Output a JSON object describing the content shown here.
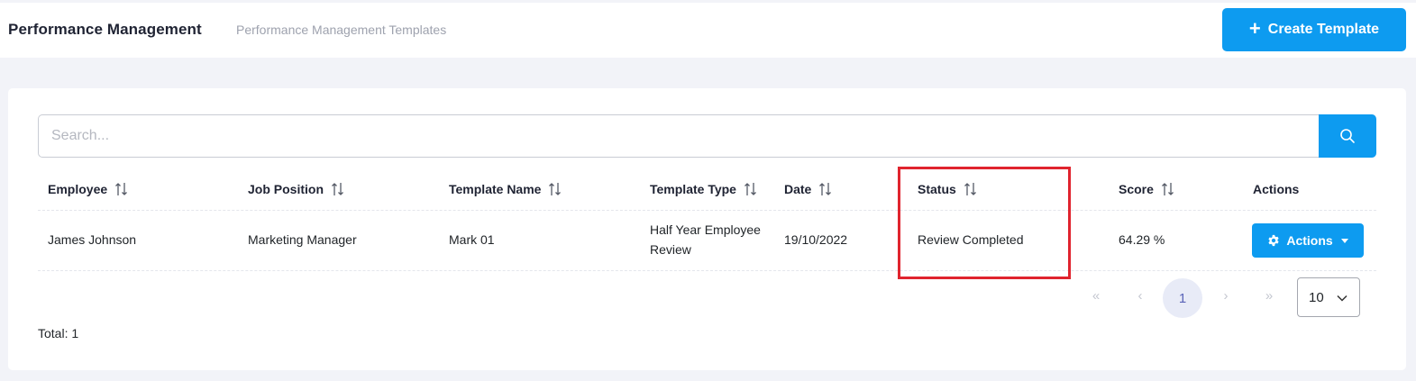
{
  "header": {
    "title": "Performance Management",
    "subtitle": "Performance Management Templates",
    "create_label": "Create Template"
  },
  "search": {
    "placeholder": "Search..."
  },
  "table": {
    "columns": [
      "Employee",
      "Job Position",
      "Template Name",
      "Template Type",
      "Date",
      "Status",
      "Score",
      "Actions"
    ],
    "rows": [
      {
        "employee": "James Johnson",
        "job_position": "Marketing Manager",
        "template_name": "Mark 01",
        "template_type_line1": "Half Year Employee",
        "template_type_line2": "Review",
        "date": "19/10/2022",
        "status": "Review Completed",
        "score": "64.29 %",
        "actions_label": "Actions"
      }
    ]
  },
  "pagination": {
    "first": "«",
    "prev": "‹",
    "current": "1",
    "next": "›",
    "last": "»",
    "per_page": "10"
  },
  "footer": {
    "total": "Total: 1"
  },
  "colors": {
    "accent": "#0d9bf0",
    "highlight": "#e0242e"
  }
}
